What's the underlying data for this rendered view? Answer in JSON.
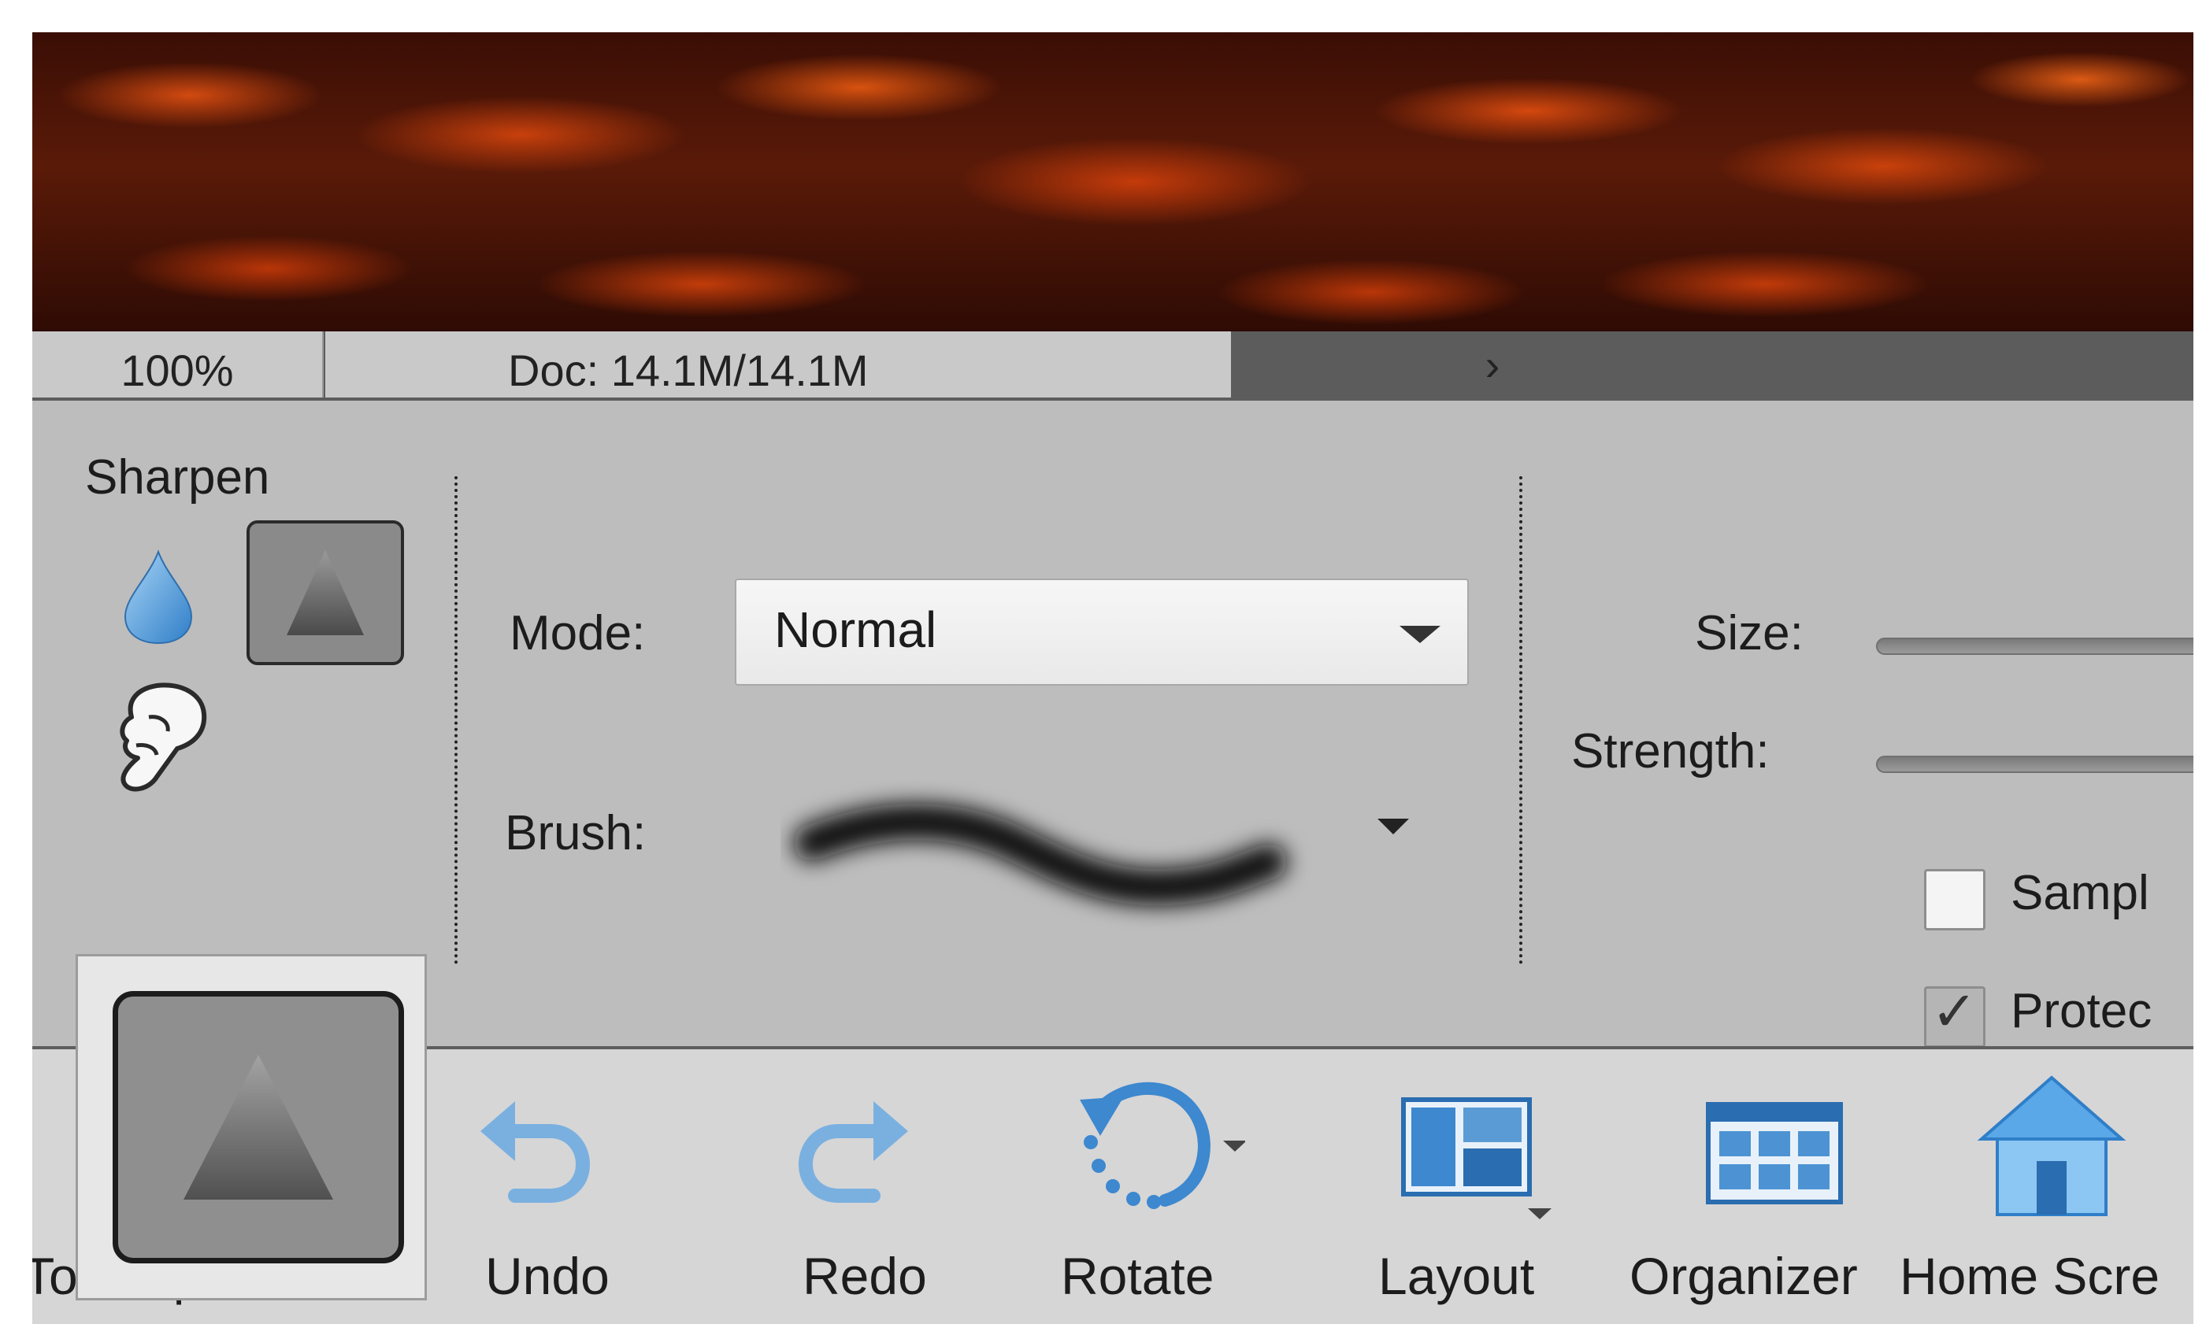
{
  "status_bar": {
    "zoom": "100%",
    "doc_info": "Doc: 14.1M/14.1M",
    "expand_glyph": "›"
  },
  "tool_options": {
    "tool_name": "Sharpen",
    "tools": [
      {
        "name": "blur",
        "icon": "water-drop-icon"
      },
      {
        "name": "sharpen",
        "icon": "triangle-icon",
        "selected": true
      },
      {
        "name": "smudge",
        "icon": "finger-icon"
      }
    ],
    "mode_label": "Mode:",
    "mode_value": "Normal",
    "brush_label": "Brush:",
    "size_label": "Size:",
    "strength_label": "Strength:",
    "sample_label": "Sampl",
    "protect_label": "Protec",
    "sample_checked": false,
    "protect_checked": true
  },
  "taskbar": {
    "tool_options_label": "Tool Options",
    "undo_label": "Undo",
    "redo_label": "Redo",
    "rotate_label": "Rotate",
    "layout_label": "Layout",
    "organizer_label": "Organizer",
    "home_label": "Home Scre"
  },
  "colors": {
    "accent_blue": "#3d88cf",
    "panel_gray": "#bdbdbd",
    "taskbar_gray": "#d6d6d6"
  }
}
